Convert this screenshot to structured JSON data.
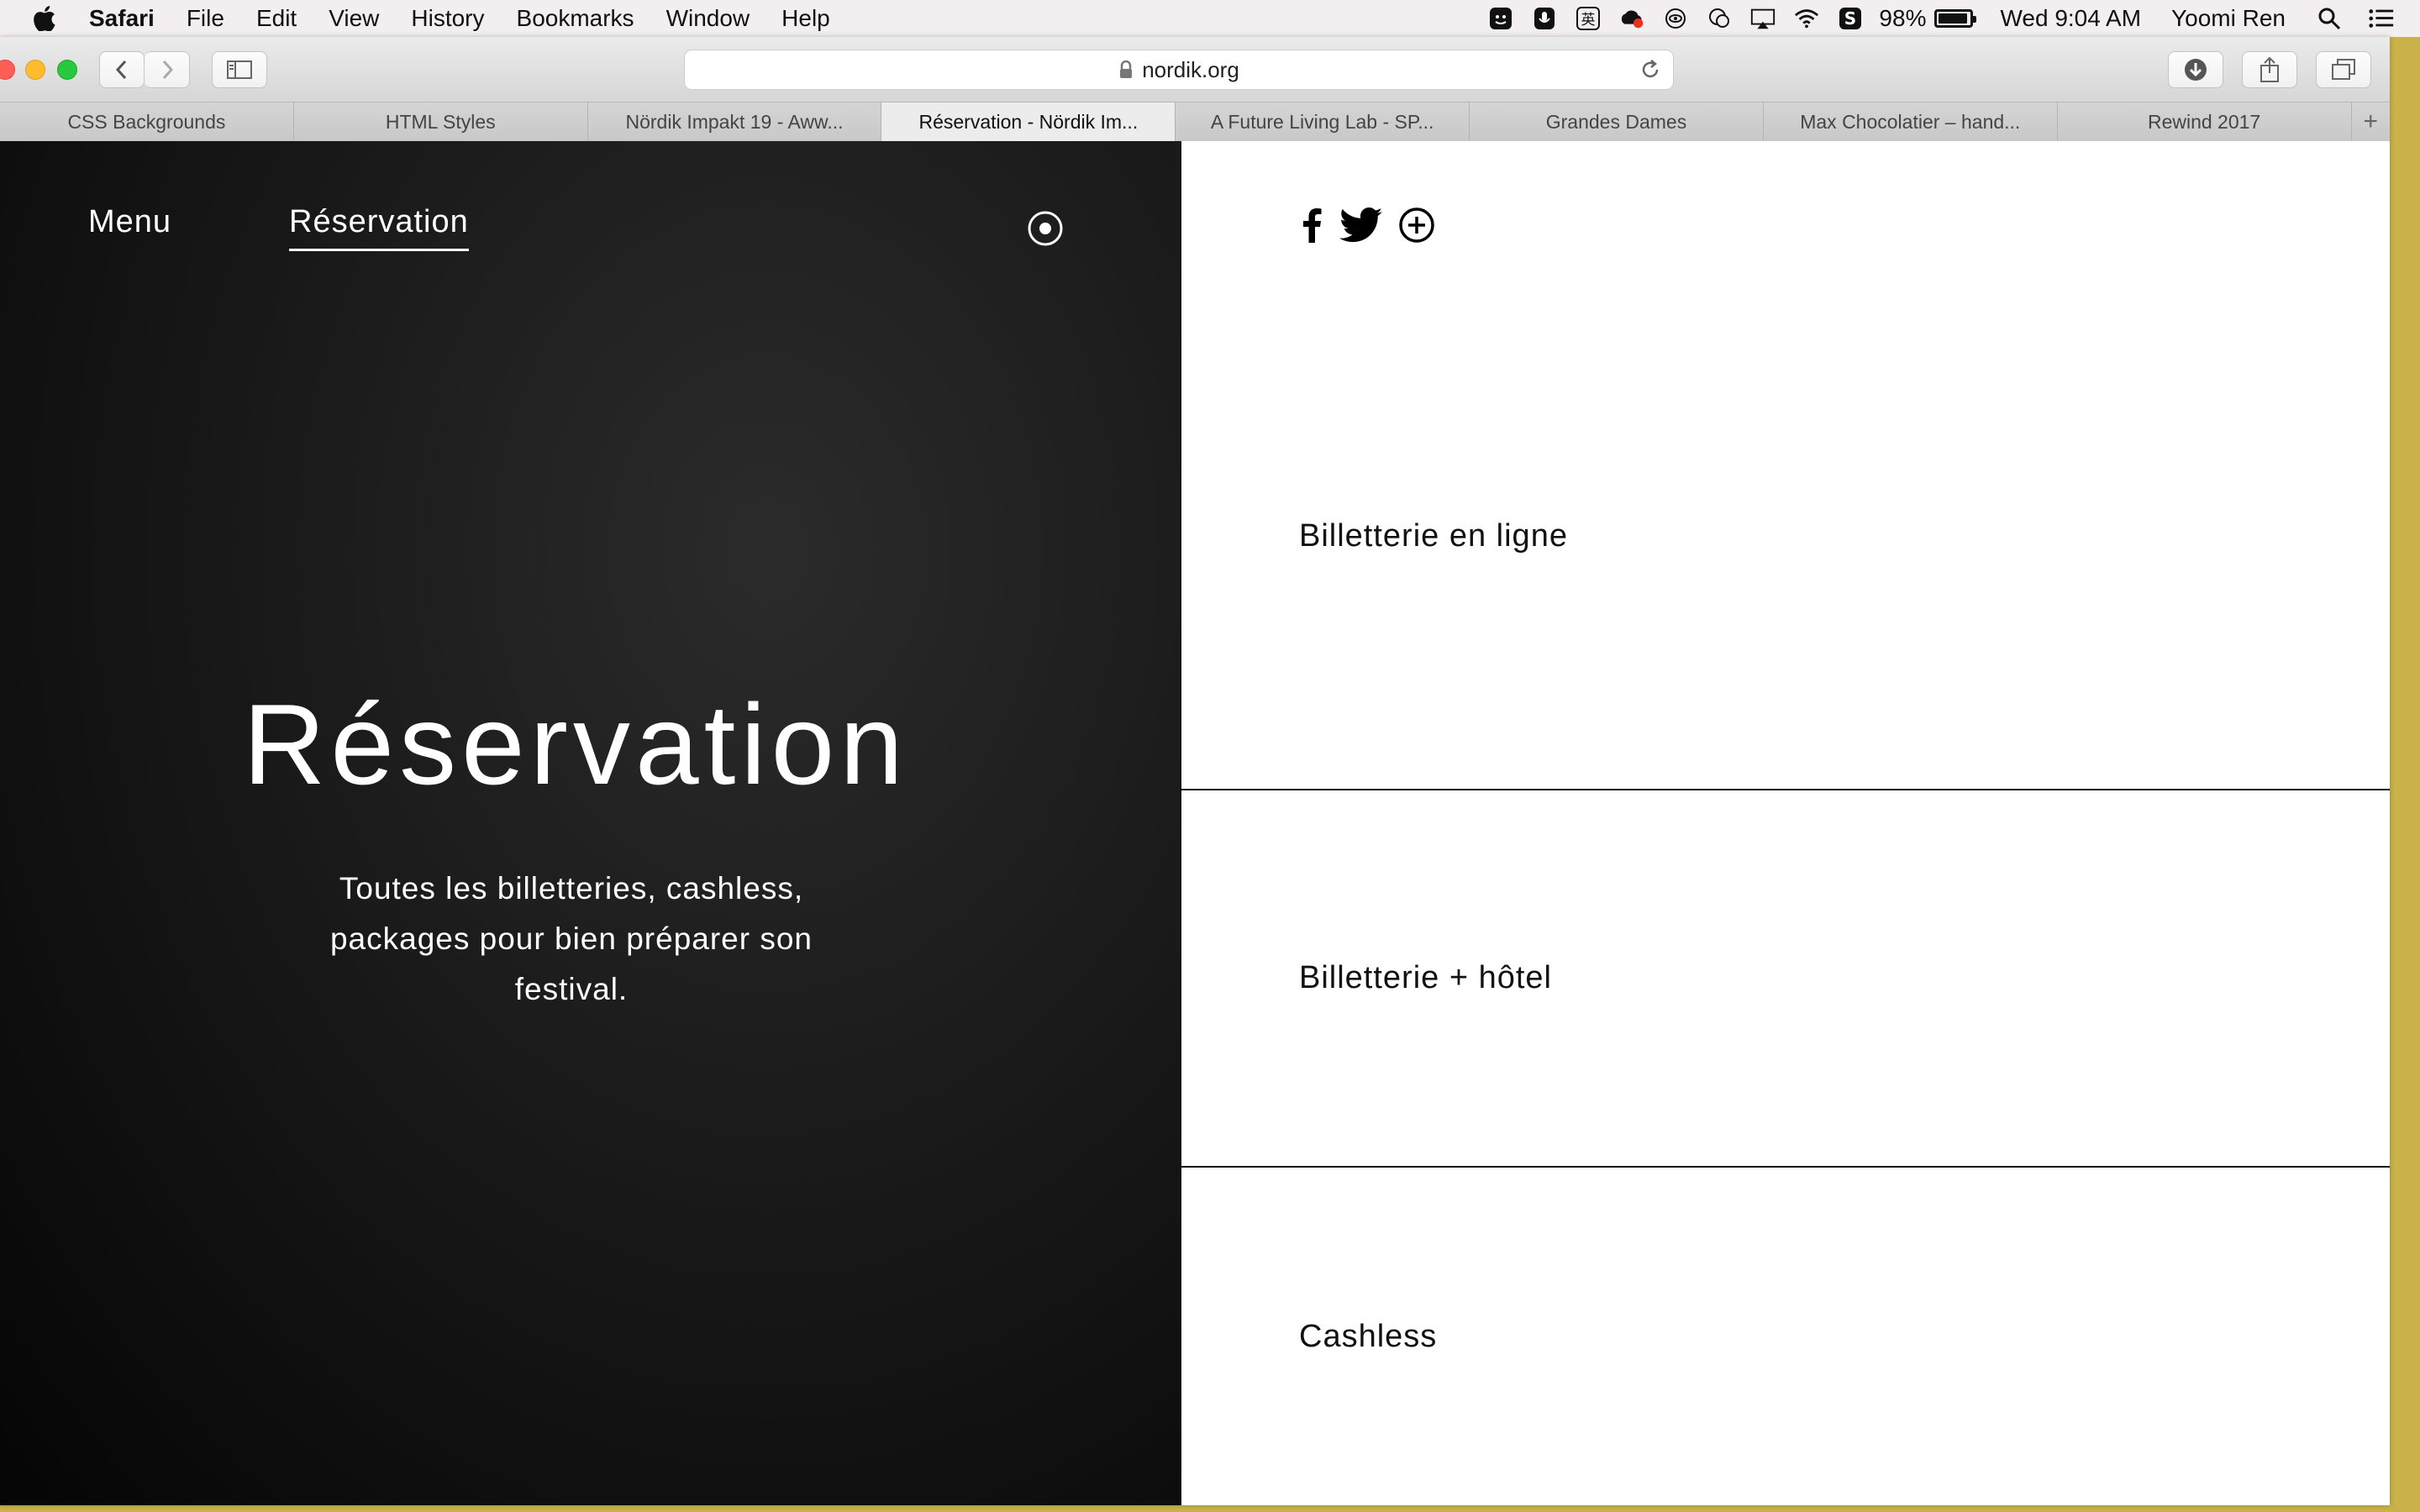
{
  "menubar": {
    "app_name": "Safari",
    "items": [
      "File",
      "Edit",
      "View",
      "History",
      "Bookmarks",
      "Window",
      "Help"
    ],
    "battery": "98%",
    "clock": "Wed 9:04 AM",
    "user": "Yoomi Ren",
    "input_method": "英"
  },
  "browser": {
    "url": "nordik.org",
    "tabs": [
      "CSS Backgrounds",
      "HTML Styles",
      "Nördik Impakt 19 - Aww...",
      "Réservation - Nördik Im...",
      "A Future Living Lab - SP...",
      "Grandes Dames",
      "Max Chocolatier – hand...",
      "Rewind 2017"
    ],
    "active_tab_index": 3,
    "new_tab": "+"
  },
  "site": {
    "nav": {
      "menu": "Menu",
      "reservation": "Réservation"
    },
    "hero": {
      "title": "Réservation",
      "subtitle": "Toutes les billetteries, cashless, packages pour bien préparer son festival."
    },
    "sections": [
      "Billetterie en ligne",
      "Billetterie + hôtel",
      "Cashless"
    ]
  },
  "colors": {
    "left_panel": "#1a1a1a",
    "right_panel": "#ffffff",
    "desktop": "#c9b24a"
  }
}
